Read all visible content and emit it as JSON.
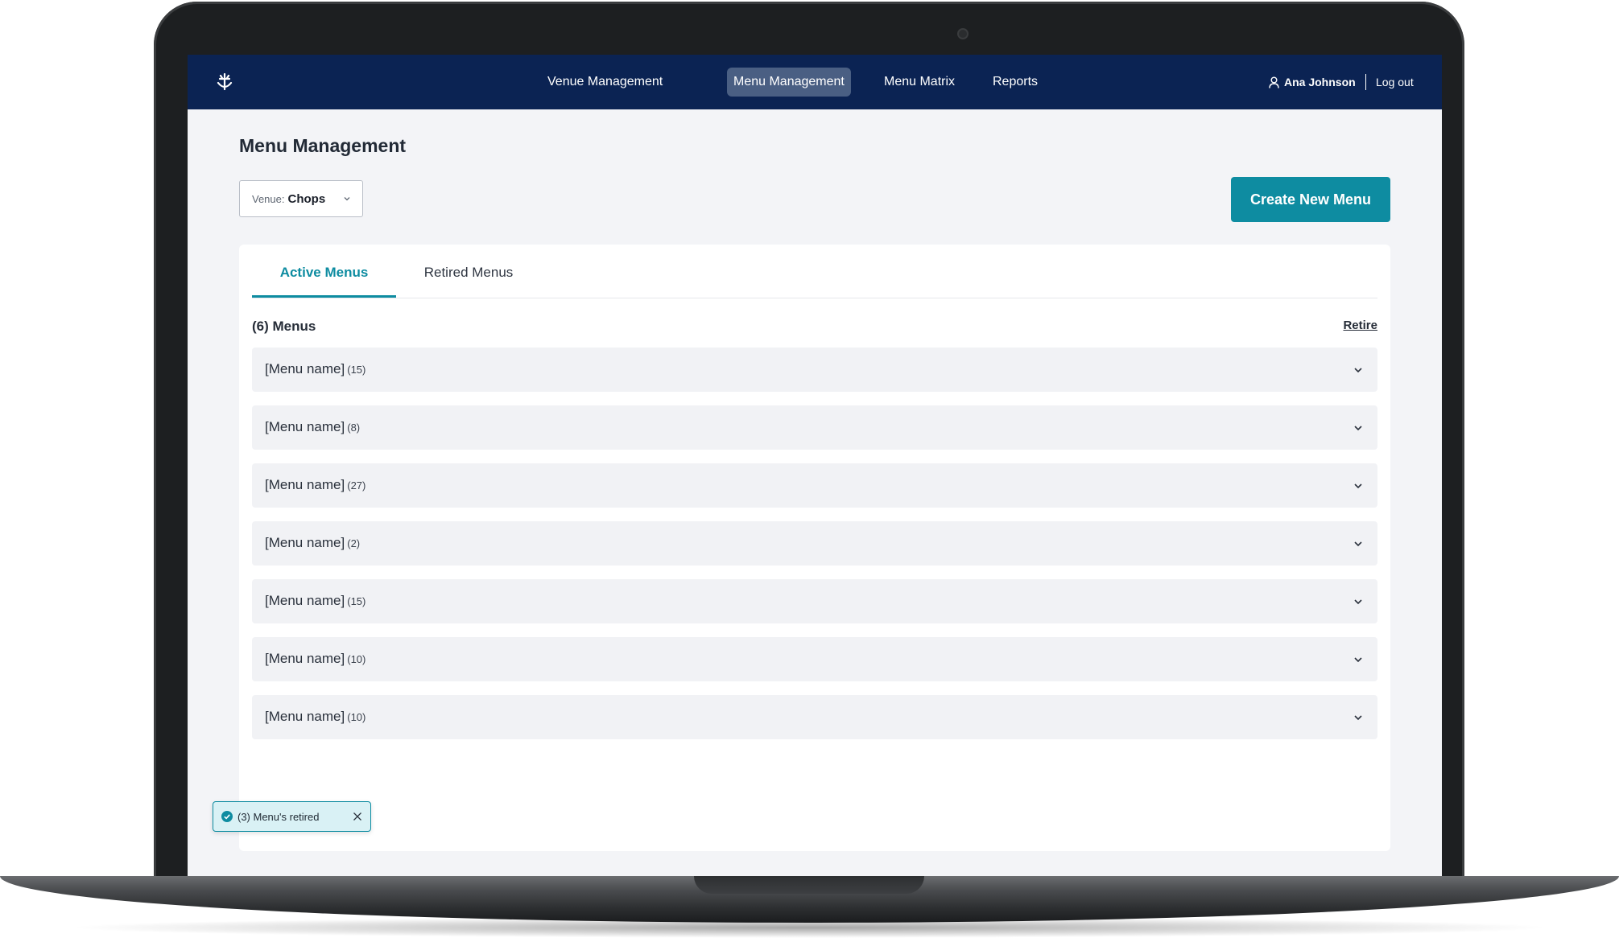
{
  "nav": {
    "items": [
      {
        "label": "Venue Management",
        "active": false
      },
      {
        "label": "Menu Management",
        "active": true
      },
      {
        "label": "Menu Matrix",
        "active": false
      },
      {
        "label": "Reports",
        "active": false
      }
    ],
    "user_name": "Ana Johnson",
    "logout_label": "Log out"
  },
  "page": {
    "title": "Menu Management",
    "venue_label": "Venue:",
    "venue_value": "Chops",
    "create_button": "Create New Menu"
  },
  "tabs": [
    {
      "label": "Active Menus",
      "active": true
    },
    {
      "label": "Retired Menus",
      "active": false
    }
  ],
  "list": {
    "count_label": "(6) Menus",
    "retire_label": "Retire",
    "menus": [
      {
        "name": "[Menu name]",
        "count": "(15)"
      },
      {
        "name": "[Menu name]",
        "count": "(8)"
      },
      {
        "name": "[Menu name]",
        "count": "(27)"
      },
      {
        "name": "[Menu name]",
        "count": "(2)"
      },
      {
        "name": "[Menu name]",
        "count": "(15)"
      },
      {
        "name": "[Menu name]",
        "count": "(10)"
      },
      {
        "name": "[Menu name]",
        "count": "(10)"
      }
    ]
  },
  "toast": {
    "message": "(3) Menu's retired"
  },
  "colors": {
    "nav_bg": "#0b2353",
    "accent": "#0e8ca1",
    "nav_active": "#4a5f83"
  },
  "icons": {
    "logo": "crown-anchor-logo-icon",
    "user": "user-icon",
    "chevron": "chevron-down-icon",
    "check": "check-circle-icon",
    "close": "close-icon"
  }
}
